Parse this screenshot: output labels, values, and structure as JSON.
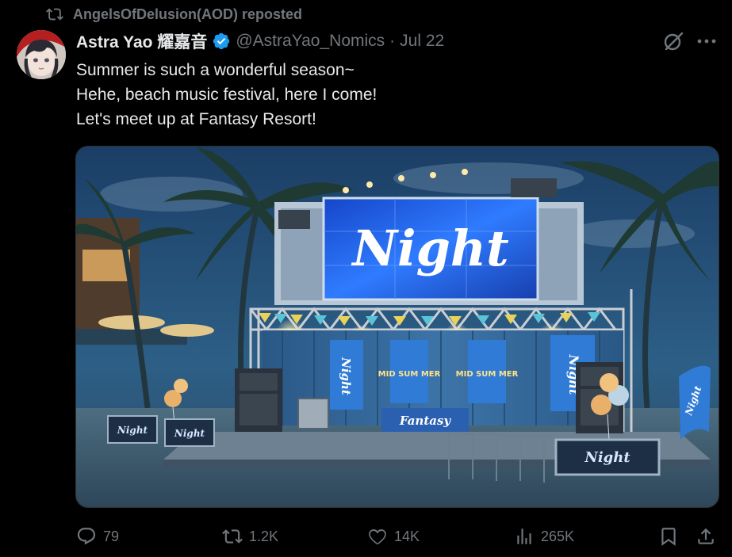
{
  "repost": {
    "text": "AngelsOfDelusion(AOD) reposted",
    "icon": "repost-icon"
  },
  "author": {
    "name": "Astra Yao 耀嘉音",
    "handle": "@AstraYao_Nomics",
    "separator": "·",
    "date": "Jul 22",
    "verified_color": "#1d9bf0"
  },
  "tweet": {
    "lines": [
      "Summer is such a wonderful season~",
      "Hehe, beach music festival, here I come!",
      "Let's meet up at Fantasy Resort!"
    ]
  },
  "media": {
    "screen_text": "Night",
    "banner_left_text": "Night",
    "banner_mid1_text": "MID SUM MER",
    "banner_mid2_text": "MID SUM MER",
    "banner_right_text": "Night",
    "desk_text": "Fantasy",
    "barrier_text": "Night",
    "flag_text": "Night"
  },
  "actions": {
    "replies": "79",
    "reposts": "1.2K",
    "likes": "14K",
    "views": "265K"
  },
  "colors": {
    "background": "#000000",
    "text": "#e7e9ea",
    "muted": "#71767b",
    "accent": "#1d9bf0"
  }
}
